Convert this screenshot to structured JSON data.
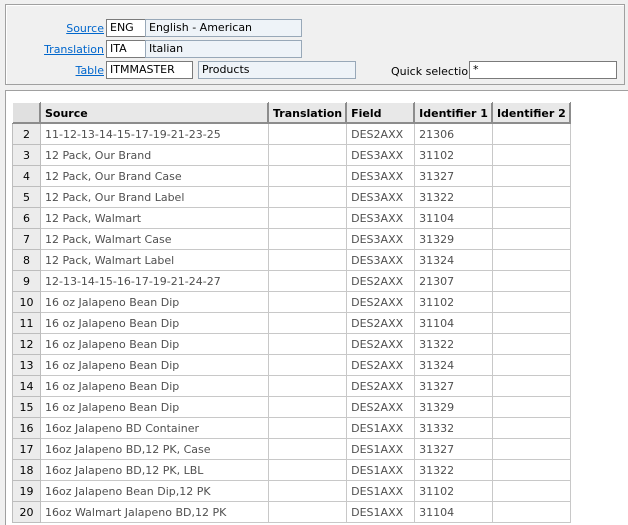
{
  "header": {
    "source": {
      "label": "Source",
      "code": "ENG",
      "name": "English - American"
    },
    "translation": {
      "label": "Translation",
      "code": "ITA",
      "name": "Italian"
    },
    "table": {
      "label": "Table",
      "code": "ITMMASTER",
      "name": "Products"
    },
    "quick_selection": {
      "label": "Quick selection",
      "value": "*"
    }
  },
  "grid": {
    "columns": [
      "Source",
      "Translation",
      "Field",
      "Identifier 1",
      "Identifier 2"
    ],
    "rows": [
      {
        "n": "2",
        "source": "11-12-13-14-15-17-19-21-23-25",
        "translation": "",
        "field": "DES2AXX",
        "id1": "21306",
        "id2": ""
      },
      {
        "n": "3",
        "source": "12 Pack, Our Brand",
        "translation": "",
        "field": "DES3AXX",
        "id1": "31102",
        "id2": ""
      },
      {
        "n": "4",
        "source": "12 Pack, Our Brand Case",
        "translation": "",
        "field": "DES3AXX",
        "id1": "31327",
        "id2": ""
      },
      {
        "n": "5",
        "source": "12 Pack, Our Brand Label",
        "translation": "",
        "field": "DES3AXX",
        "id1": "31322",
        "id2": ""
      },
      {
        "n": "6",
        "source": "12 Pack, Walmart",
        "translation": "",
        "field": "DES3AXX",
        "id1": "31104",
        "id2": ""
      },
      {
        "n": "7",
        "source": "12 Pack, Walmart Case",
        "translation": "",
        "field": "DES3AXX",
        "id1": "31329",
        "id2": ""
      },
      {
        "n": "8",
        "source": "12 Pack, Walmart Label",
        "translation": "",
        "field": "DES3AXX",
        "id1": "31324",
        "id2": ""
      },
      {
        "n": "9",
        "source": "12-13-14-15-16-17-19-21-24-27",
        "translation": "",
        "field": "DES2AXX",
        "id1": "21307",
        "id2": ""
      },
      {
        "n": "10",
        "source": "16 oz Jalapeno Bean Dip",
        "translation": "",
        "field": "DES2AXX",
        "id1": "31102",
        "id2": ""
      },
      {
        "n": "11",
        "source": "16 oz Jalapeno Bean Dip",
        "translation": "",
        "field": "DES2AXX",
        "id1": "31104",
        "id2": ""
      },
      {
        "n": "12",
        "source": "16 oz Jalapeno Bean Dip",
        "translation": "",
        "field": "DES2AXX",
        "id1": "31322",
        "id2": ""
      },
      {
        "n": "13",
        "source": "16 oz Jalapeno Bean Dip",
        "translation": "",
        "field": "DES2AXX",
        "id1": "31324",
        "id2": ""
      },
      {
        "n": "14",
        "source": "16 oz Jalapeno Bean Dip",
        "translation": "",
        "field": "DES2AXX",
        "id1": "31327",
        "id2": ""
      },
      {
        "n": "15",
        "source": "16 oz Jalapeno Bean Dip",
        "translation": "",
        "field": "DES2AXX",
        "id1": "31329",
        "id2": ""
      },
      {
        "n": "16",
        "source": "16oz Jalapeno BD Container",
        "translation": "",
        "field": "DES1AXX",
        "id1": "31332",
        "id2": ""
      },
      {
        "n": "17",
        "source": "16oz Jalapeno BD,12 PK, Case",
        "translation": "",
        "field": "DES1AXX",
        "id1": "31327",
        "id2": ""
      },
      {
        "n": "18",
        "source": "16oz Jalapeno BD,12 PK, LBL",
        "translation": "",
        "field": "DES1AXX",
        "id1": "31322",
        "id2": ""
      },
      {
        "n": "19",
        "source": "16oz Jalapeno Bean Dip,12 PK",
        "translation": "",
        "field": "DES1AXX",
        "id1": "31102",
        "id2": ""
      },
      {
        "n": "20",
        "source": "16oz Walmart Jalapeno BD,12 PK",
        "translation": "",
        "field": "DES1AXX",
        "id1": "31104",
        "id2": ""
      }
    ]
  }
}
